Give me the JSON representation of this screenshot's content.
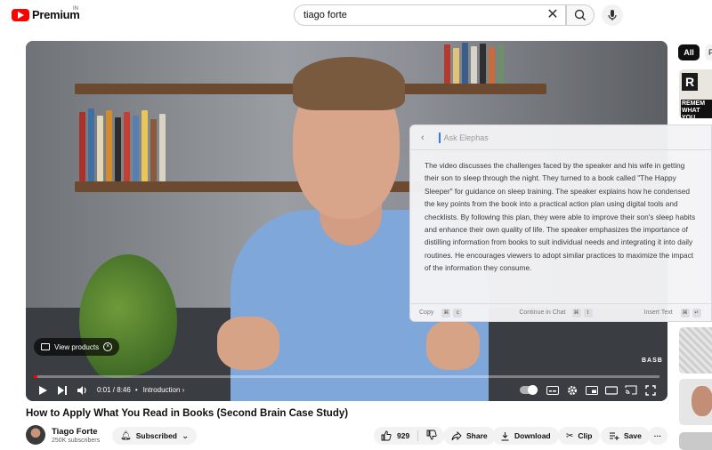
{
  "header": {
    "logo_text": "Premium",
    "logo_region": "IN",
    "search_value": "tiago forte"
  },
  "player": {
    "view_products_label": "View products",
    "watermark": "BASB",
    "time": "0:01 / 8:46",
    "chapter": "Introduction",
    "progress": 0.002
  },
  "elephas": {
    "placeholder": "Ask Elephas",
    "summary": "The video discusses the challenges faced by the speaker and his wife in getting their son to sleep through the night. They turned to a book called \"The Happy Sleeper\" for guidance on sleep training. The speaker explains how he condensed the key points from the book into a practical action plan using digital tools and checklists. By following this plan, they were able to improve their son's sleep habits and enhance their own quality of life. The speaker emphasizes the importance of distilling information from books to suit individual needs and integrating it into daily routines. He encourages viewers to adopt similar practices to maximize the impact of the information they consume.",
    "copy_label": "Copy",
    "copy_keys": [
      "⌘",
      "c"
    ],
    "chat_label": "Continue in Chat",
    "chat_keys": [
      "⌘",
      "t"
    ],
    "insert_label": "Insert Text",
    "insert_keys": [
      "⌘",
      "↵"
    ]
  },
  "sidebar": {
    "chip_all": "All",
    "chip_next": "F",
    "thumb1_letter": "R",
    "thumb1_text": "REMEM WHAT YOU"
  },
  "video": {
    "title": "How to Apply What You Read in Books (Second Brain Case Study)",
    "channel": "Tiago Forte",
    "subscribers": "250K subscribers",
    "subscribed_label": "Subscribed",
    "likes": "929",
    "share_label": "Share",
    "download_label": "Download",
    "clip_label": "Clip",
    "save_label": "Save",
    "more_label": "···"
  }
}
